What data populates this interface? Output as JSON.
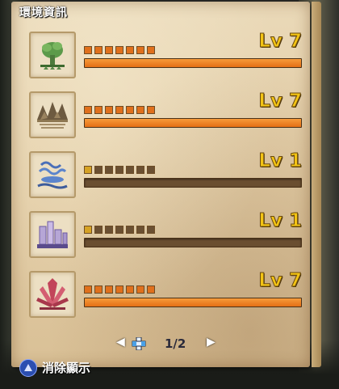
{
  "title": "環境資訊",
  "entries": [
    {
      "icon": "tree-icon",
      "level_label": "Lv 7",
      "level": 7,
      "max_level": 7,
      "progress": 1.0
    },
    {
      "icon": "cliff-icon",
      "level_label": "Lv 7",
      "level": 7,
      "max_level": 7,
      "progress": 1.0
    },
    {
      "icon": "water-icon",
      "level_label": "Lv 1",
      "level": 1,
      "max_level": 7,
      "progress": 0.0
    },
    {
      "icon": "ruins-icon",
      "level_label": "Lv 1",
      "level": 1,
      "max_level": 7,
      "progress": 0.0
    },
    {
      "icon": "crystal-icon",
      "level_label": "Lv 7",
      "level": 7,
      "max_level": 7,
      "progress": 1.0
    }
  ],
  "pager": {
    "text": "1/2",
    "prev": "◀",
    "next": "▶"
  },
  "footer": {
    "label": "消除顯示"
  },
  "colors": {
    "accent": "#e46f15",
    "level_text": "#f3c414",
    "dot_first": "#d6a224"
  }
}
